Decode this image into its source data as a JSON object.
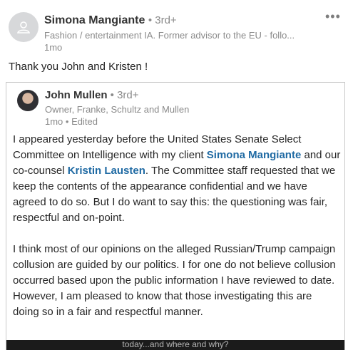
{
  "post": {
    "author_name": "Simona Mangiante",
    "degree": "3rd+",
    "headline": "Fashion / entertainment IA. Former advisor to the EU - follo...",
    "time": "1mo",
    "text": "Thank you John and Kristen !",
    "more_icon": "more-options-icon"
  },
  "shared": {
    "author_name": "John Mullen",
    "degree": "3rd+",
    "headline": "Owner, Franke, Schultz and Mullen",
    "time": "1mo • Edited",
    "p1_a": "I appeared yesterday before the United States Senate Select Committee on Intelligence with my client ",
    "mention1": "Simona Mangiante",
    "p1_b": " and our co-counsel ",
    "mention2": "Kristin Lausten",
    "p1_c": ".  The Committee staff requested that we keep the contents of the appearance confidential and we have agreed to do so.  But I do want to say this: the questioning was fair, respectful and on-point.",
    "p2": "I think most of our opinions on the alleged Russian/Trump campaign collusion are guided by our politics.  I for one do not believe collusion occurred based upon the public information I have reviewed to date.  However, I am pleased to know that those investigating this are doing so in a fair and respectful manner.",
    "video_caption": "today...and where and why?"
  },
  "colors": {
    "link": "#1f6aa3",
    "muted": "#8a8a8a"
  }
}
